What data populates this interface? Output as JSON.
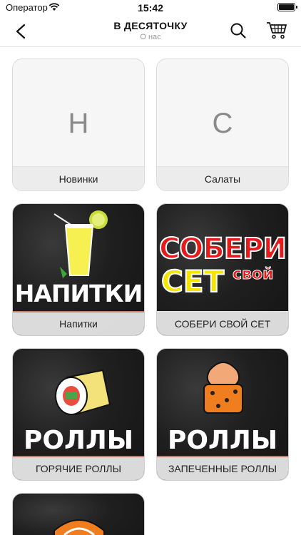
{
  "status_bar": {
    "carrier": "Оператор",
    "time": "15:42"
  },
  "nav": {
    "title": "В ДЕСЯТОЧКУ",
    "subtitle": "О нас"
  },
  "categories": [
    {
      "letter": "Н",
      "label": "Новинки"
    },
    {
      "letter": "С",
      "label": "Салаты"
    },
    {
      "label": "Напитки",
      "art_text": "НАПИТКИ"
    },
    {
      "label": "СОБЕРИ СВОЙ СЕТ",
      "art_text_1": "СОБЕРИ",
      "art_text_2": "СЕТ",
      "art_text_3": "свой"
    },
    {
      "label": "ГОРЯЧИЕ РОЛЛЫ",
      "art_text": "РОЛЛЫ"
    },
    {
      "label": "ЗАПЕЧЕННЫЕ РОЛЛЫ",
      "art_text": "РОЛЛЫ"
    }
  ],
  "colors": {
    "accent_red": "#e31b1b",
    "accent_yellow": "#f5e400",
    "dark_bg": "#1c1c1c"
  }
}
